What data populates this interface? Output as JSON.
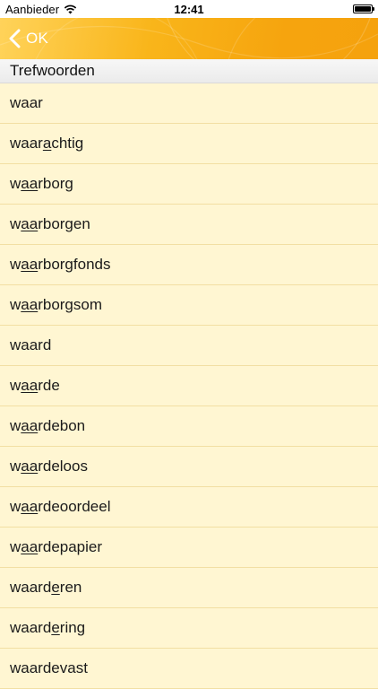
{
  "status_bar": {
    "carrier": "Aanbieder",
    "time": "12:41"
  },
  "nav": {
    "back_label": "OK",
    "icons": [
      "chevron-left-icon"
    ]
  },
  "section": {
    "title": "Trefwoorden"
  },
  "colors": {
    "nav_orange": "#f6a40e",
    "list_background": "#fff6d2",
    "row_separator": "#f2dfa3"
  },
  "words": [
    {
      "word": "waar",
      "stress": null
    },
    {
      "word": "waarachtig",
      "stress": "a",
      "stress_index": 4
    },
    {
      "word": "waarborg",
      "stress": "aa",
      "stress_index": 1
    },
    {
      "word": "waarborgen",
      "stress": "aa",
      "stress_index": 1
    },
    {
      "word": "waarborgfonds",
      "stress": "aa",
      "stress_index": 1
    },
    {
      "word": "waarborgsom",
      "stress": "aa",
      "stress_index": 1
    },
    {
      "word": "waard",
      "stress": null
    },
    {
      "word": "waarde",
      "stress": "aa",
      "stress_index": 1
    },
    {
      "word": "waardebon",
      "stress": "aa",
      "stress_index": 1
    },
    {
      "word": "waardeloos",
      "stress": "aa",
      "stress_index": 1
    },
    {
      "word": "waardeoordeel",
      "stress": "aa",
      "stress_index": 1
    },
    {
      "word": "waardepapier",
      "stress": "aa",
      "stress_index": 1
    },
    {
      "word": "waarderen",
      "stress": "e",
      "stress_index": 5
    },
    {
      "word": "waardering",
      "stress": "e",
      "stress_index": 5
    },
    {
      "word": "waardevast",
      "stress": null
    }
  ]
}
